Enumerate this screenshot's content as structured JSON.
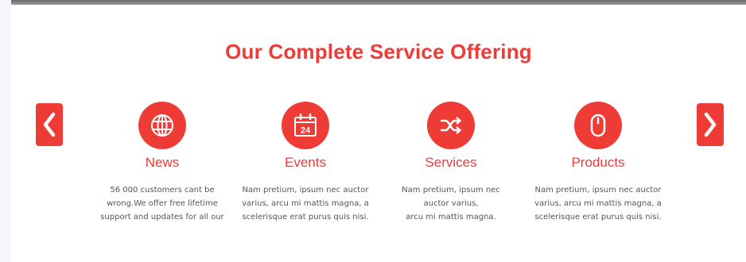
{
  "section": {
    "title": "Our Complete Service Offering"
  },
  "colors": {
    "accent": "#ef3b36",
    "text": "#555555",
    "background": "#ffffff"
  },
  "carousel": {
    "prev_icon": "chevron-left-icon",
    "next_icon": "chevron-right-icon",
    "items": [
      {
        "icon": "globe-icon",
        "title": "News",
        "lines": [
          "56 000 customers cant be",
          "wrong.We offer free lifetime",
          "support and updates for all our"
        ]
      },
      {
        "icon": "calendar-icon",
        "icon_text": "24",
        "title": "Events",
        "lines": [
          "Nam pretium, ipsum nec auctor",
          "varius, arcu mi mattis magna, a",
          "scelerisque erat purus quis nisi."
        ]
      },
      {
        "icon": "shuffle-icon",
        "title": "Services",
        "lines": [
          "Nam pretium, ipsum nec",
          "auctor varius,",
          "arcu mi mattis magna."
        ]
      },
      {
        "icon": "mouse-icon",
        "title": "Products",
        "lines": [
          "Nam pretium, ipsum nec auctor",
          "varius, arcu mi mattis magna, a",
          "scelerisque erat purus quis nisi."
        ]
      }
    ]
  }
}
